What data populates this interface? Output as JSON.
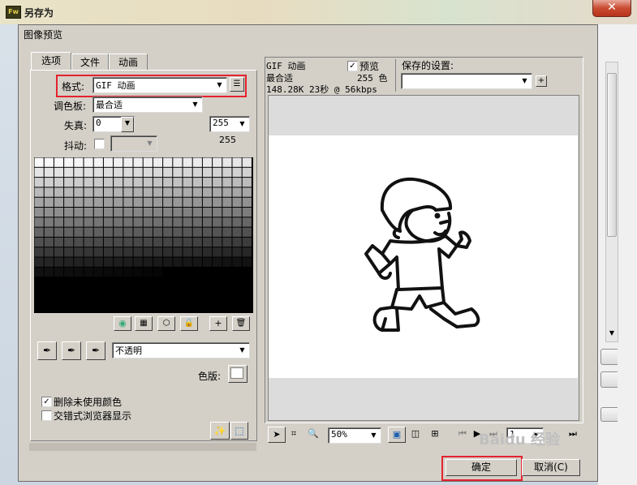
{
  "window": {
    "title": "另存为",
    "app_icon": "Fw"
  },
  "dialog": {
    "title": "图像预览"
  },
  "tabs": [
    {
      "label": "选项"
    },
    {
      "label": "文件"
    },
    {
      "label": "动画"
    }
  ],
  "options": {
    "format_label": "格式:",
    "format_value": "GIF 动画",
    "palette_label": "调色板:",
    "palette_value": "最合适",
    "loss_label": "失真:",
    "loss_value": "0",
    "dither_label": "抖动:",
    "colors_value": "255",
    "colors_count": "255",
    "transparency_value": "不透明",
    "matte_label": "色版:",
    "remove_unused_label": "删除未使用颜色",
    "interlaced_label": "交错式浏览器显示",
    "remove_unused_checked": true,
    "interlaced_checked": false
  },
  "preview": {
    "format": "GIF 动画",
    "palette": "最合适",
    "stats": "148.28K  23秒 @ 56kbps",
    "colors": "255 色",
    "preview_label": "预览",
    "preview_checked": true,
    "saved_settings_label": "保存的设置:"
  },
  "toolbar": {
    "zoom_value": "50%",
    "frame_value": "1"
  },
  "buttons": {
    "ok": "确定",
    "cancel": "取消(C)"
  },
  "watermark": "Baidu 经验",
  "colors": {
    "highlight_red": "#e5222e",
    "dialog_bg": "#d4d0c8"
  }
}
